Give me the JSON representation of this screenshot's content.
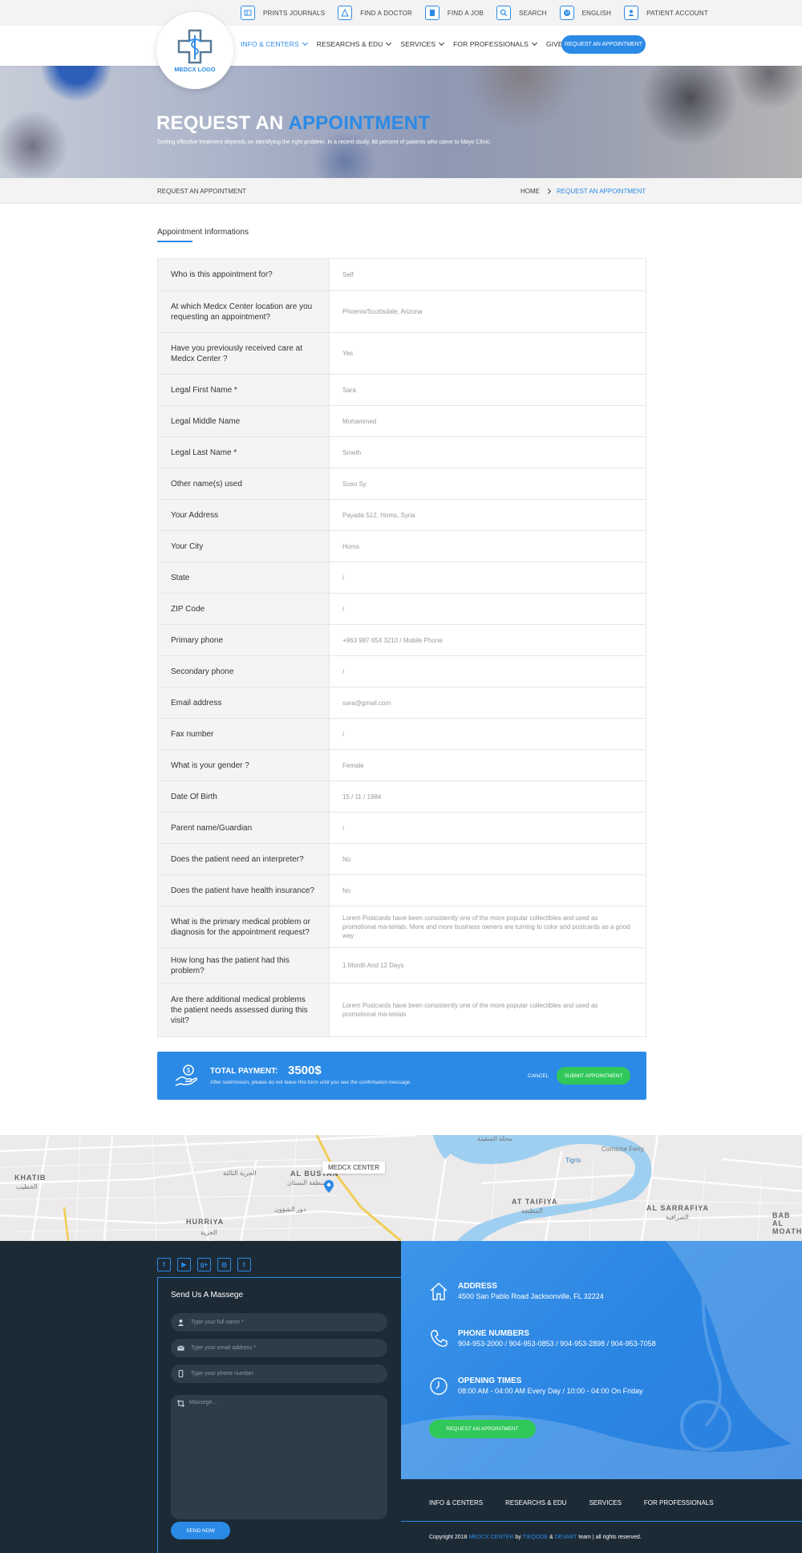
{
  "colors": {
    "primary": "#2b8ae6",
    "green": "#31c85a",
    "dark": "#1c2a36"
  },
  "topbar": {
    "links": [
      {
        "icon": "journal-icon",
        "label": "PRINTS JOURNALS"
      },
      {
        "icon": "doctor-icon",
        "label": "FIND A DOCTOR"
      },
      {
        "icon": "document-icon",
        "label": "FIND A JOB"
      },
      {
        "icon": "search-icon",
        "label": "SEARCH"
      },
      {
        "icon": "globe-icon",
        "label": "ENGLISH"
      },
      {
        "icon": "user-icon",
        "label": "PATIENT ACCOUNT"
      }
    ]
  },
  "logo": {
    "text": "MEDCX LOGO"
  },
  "nav": {
    "items": [
      "INFO & CENTERS",
      "RESEARCHS & EDU",
      "SERVICES",
      "FOR PROFESSIONALS",
      "GIVE TO US"
    ],
    "cta": "REQUEST AN APPOINTMENT"
  },
  "hero": {
    "title_a": "REQUEST AN",
    "title_b": "APPOINTMENT",
    "subtitle": "Getting effective treatment depends on identifying the right problem. In a recent study, 88 percent of patients who came to Mayo Clinic."
  },
  "breadcrumb": {
    "page": "REQUEST AN APPOINTMENT",
    "home": "HOME",
    "current": "REQUEST AN APPOINTMENT"
  },
  "section": {
    "title": "Appointment Informations"
  },
  "form": {
    "rows": [
      {
        "label": "Who is this appointment for?",
        "value": "Self"
      },
      {
        "label": "At which Medcx Center location are you requesting an appointment?",
        "value": "Phoenix/Scottsdale, Arizona"
      },
      {
        "label": "Have you previously received care at Medcx Center ?",
        "value": "Yes"
      },
      {
        "label": "Legal First Name *",
        "value": "Sara"
      },
      {
        "label": "Legal Middle Name",
        "value": "Mohammed"
      },
      {
        "label": "Legal Last Name *",
        "value": "Smeth"
      },
      {
        "label": "Other name(s) used",
        "value": "Soso Sy"
      },
      {
        "label": "Your Address",
        "value": "Payada 512, Homs, Syria"
      },
      {
        "label": "Your City",
        "value": "Homs"
      },
      {
        "label": "State",
        "value": "/"
      },
      {
        "label": "ZIP Code",
        "value": "/"
      },
      {
        "label": "Primary phone",
        "value": "+963 987 654 3210 / Mobile Phone"
      },
      {
        "label": "Secondary phone",
        "value": "/"
      },
      {
        "label": "Email address",
        "value": "sara@gmail.com"
      },
      {
        "label": "Fax number",
        "value": "/"
      },
      {
        "label": "What is your gender ?",
        "value": "Female"
      },
      {
        "label": "Date Of Birth",
        "value": "15 / 11 / 1984"
      },
      {
        "label": "Parent name/Guardian",
        "value": "/"
      },
      {
        "label": "Does the patient need an interpreter?",
        "value": "No"
      },
      {
        "label": "Does the patient have health insurance?",
        "value": "No"
      },
      {
        "label": "What is the primary medical problem or diagnosis for the appointment request?",
        "value": "Lorem Postcards have been consistently one of the more popular collectibles and used as promotional ma-terials. More and more business owners are turning to color and postcards as a good way"
      },
      {
        "label": "How long has the patient had this problem?",
        "value": "1 Month And 12 Days"
      },
      {
        "label": "Are there additional medical problems the patient needs assessed during this visit?",
        "value": "Lorem Postcards have been consistently one of the more popular collectibles and used as promotional ma-terials"
      }
    ]
  },
  "payment": {
    "label": "TOTAL PAYMENT:",
    "amount": "3500$",
    "note": "After submission, please do not leave this form until you see the confirmation message.",
    "cancel": "CANCEL",
    "submit": "SUBMIT APPOINTMENT"
  },
  "map": {
    "tag": "MEDCX CENTER",
    "labels": [
      "KHATIB",
      "AL BUSTAN",
      "HURRIYA",
      "AT TAIFIYA",
      "AL SARRAFIYA",
      "BAB AL MOATHAM",
      "Corniche Ferry",
      "Tigris"
    ],
    "arabic": [
      "الخطيب",
      "الحرية الثالثة",
      "منطقة البستان",
      "دور الشؤون",
      "الحرية",
      "المطيفة",
      "الصرافية",
      "محلة السفينة"
    ]
  },
  "contact": {
    "title": "Send Us A Massege",
    "name_placeholder": "Type your full name *",
    "email_placeholder": "Type your email address *",
    "phone_placeholder": "Type your phone number",
    "message_placeholder": "Massege...",
    "send": "SEND NOW"
  },
  "socials": [
    "f",
    "▶",
    "g+",
    "◎",
    "t"
  ],
  "info": {
    "address_title": "ADDRESS",
    "address": "4500 San Pablo Road Jacksonville, FL 32224",
    "phone_title": "PHONE NUMBERS",
    "phones": "904-953-2000 / 904-953-0853 / 904-953-2898 / 904-953-7058",
    "hours_title": "OPENING TIMES",
    "hours": "08:00 AM - 04:00 AM Every Day / 10:00 - 04:00 On Friday",
    "cta": "REQUEST AN APPOINTMENT"
  },
  "footer": {
    "links": [
      "INFO & CENTERS",
      "RESEARCHS & EDU",
      "SERVICES",
      "FOR PROFESSIONALS"
    ],
    "copy_a": "Copyright 2018",
    "copy_b": "MEDCX CENTER",
    "copy_c": "by",
    "copy_d": "TIEQODE",
    "copy_e": "&",
    "copy_f": "DEVART",
    "copy_g": "team | all rights reserved."
  }
}
